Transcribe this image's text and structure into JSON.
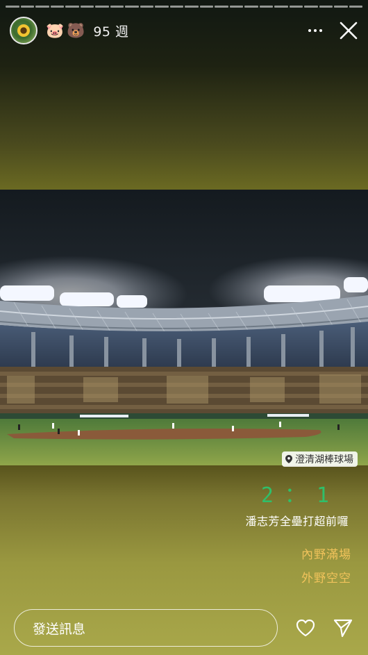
{
  "story": {
    "segments": 24
  },
  "header": {
    "emoji_1": "🐷",
    "emoji_2": "🐻",
    "week_label": "95 週"
  },
  "photo": {
    "description_alt": "Night baseball stadium with floodlights"
  },
  "overlays": {
    "location": "澄清湖棒球場",
    "score": "2：1",
    "caption": "潘志芳全壘打超前囉",
    "note_1": "內野滿場",
    "note_2": "外野空空"
  },
  "bottom_bar": {
    "message_placeholder": "發送訊息"
  },
  "colors": {
    "score": "#2fbf6a",
    "notes": "#f1c35b"
  }
}
